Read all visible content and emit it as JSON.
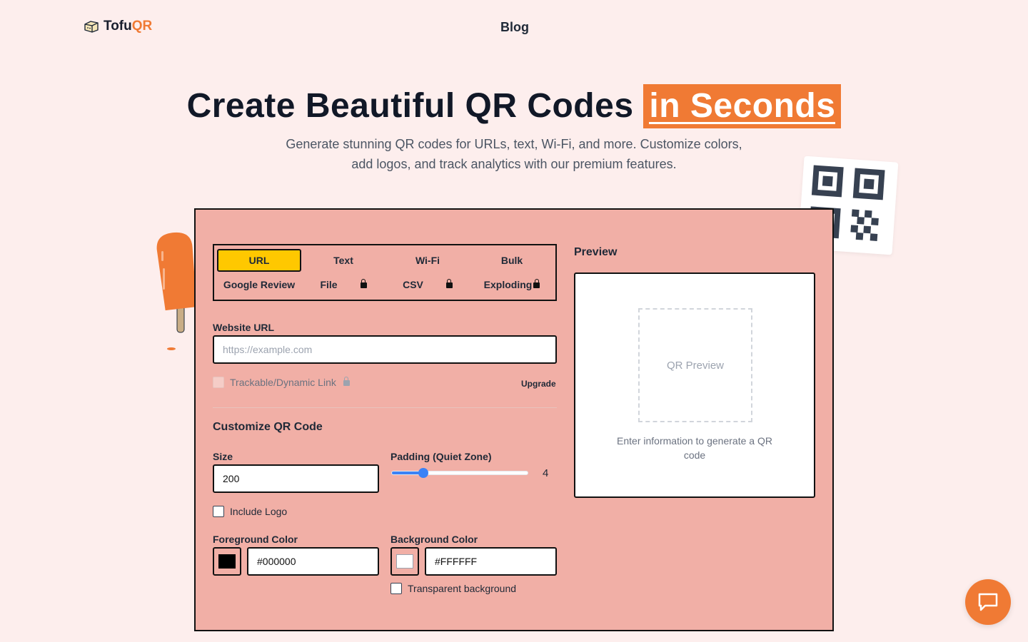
{
  "brand": {
    "name_part1": "Tofu",
    "name_part2": "QR"
  },
  "nav": {
    "blog": "Blog"
  },
  "hero": {
    "title_main": "Create Beautiful QR Codes",
    "title_highlight": "in Seconds",
    "subtitle_line1": "Generate stunning QR codes for URLs, text, Wi-Fi, and more. Customize colors,",
    "subtitle_line2": "add logos, and track analytics with our premium features."
  },
  "tabs": {
    "url": "URL",
    "text": "Text",
    "wifi": "Wi-Fi",
    "bulk": "Bulk",
    "google_review": "Google Review",
    "file": "File",
    "csv": "CSV",
    "exploding": "Exploding"
  },
  "form": {
    "website_url_label": "Website URL",
    "website_url_placeholder": "https://example.com",
    "website_url_value": "",
    "trackable_label": "Trackable/Dynamic Link",
    "upgrade": "Upgrade",
    "customize_title": "Customize QR Code",
    "size_label": "Size",
    "size_value": "200",
    "padding_label": "Padding (Quiet Zone)",
    "padding_value": "4",
    "padding_fraction": 0.2,
    "include_logo_label": "Include Logo",
    "fg_label": "Foreground Color",
    "fg_value": "#000000",
    "bg_label": "Background Color",
    "bg_value": "#FFFFFF",
    "transparent_label": "Transparent background"
  },
  "preview": {
    "title": "Preview",
    "placeholder": "QR Preview",
    "hint": "Enter information to generate a QR code"
  },
  "colors": {
    "accent": "#f07a34",
    "active_tab": "#ffc800",
    "card_bg": "#f1afa6",
    "page_bg": "#fdeeed",
    "slider": "#3b82f6"
  },
  "icons": {
    "logo": "tofu-block-icon",
    "lock": "lock-icon",
    "chat": "chat-bubble-icon",
    "qr_deco": "qr-code-icon",
    "popsicle": "popsicle-icon"
  }
}
